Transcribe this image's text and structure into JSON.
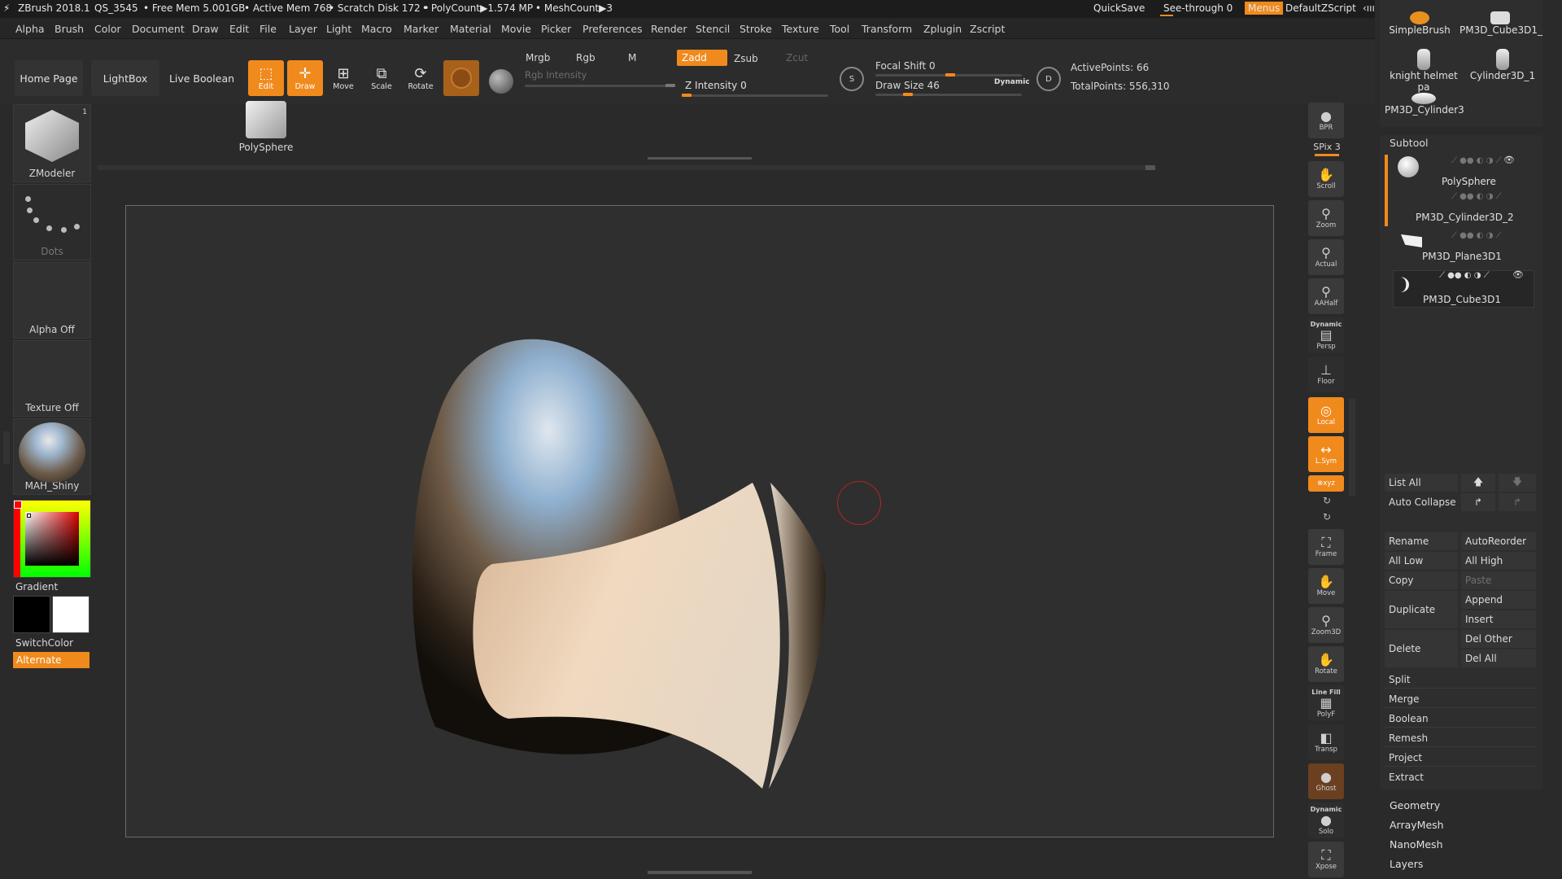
{
  "title_bar": {
    "app": "ZBrush 2018.1",
    "doc": "QS_3545",
    "free_mem": "• Free Mem 5.001GB",
    "active_mem": "• Active Mem 768",
    "scratch": "• Scratch Disk 172 •",
    "polycount": "• PolyCount▶1.574 MP",
    "meshcount": "• MeshCount▶3",
    "quicksave": "QuickSave",
    "see_through": "See-through  0",
    "menus": "Menus",
    "zscript": "DefaultZScript"
  },
  "menu": [
    "Alpha",
    "Brush",
    "Color",
    "Document",
    "Draw",
    "Edit",
    "File",
    "Layer",
    "Light",
    "Macro",
    "Marker",
    "Material",
    "Movie",
    "Picker",
    "Preferences",
    "Render",
    "Stencil",
    "Stroke",
    "Texture",
    "Tool",
    "Transform",
    "Zplugin",
    "Zscript"
  ],
  "toolbar": {
    "home": "Home Page",
    "lightbox": "LightBox",
    "live_boolean": "Live Boolean",
    "edit": "Edit",
    "draw": "Draw",
    "move": "Move",
    "scale": "Scale",
    "rotate": "Rotate",
    "mrgb": "Mrgb",
    "rgb": "Rgb",
    "m": "M",
    "zadd": "Zadd",
    "zsub": "Zsub",
    "zcut": "Zcut",
    "rgb_intensity": "Rgb Intensity",
    "z_intensity": "Z Intensity 0",
    "focal_shift": "Focal Shift 0",
    "draw_size": "Draw Size 46",
    "dynamic": "Dynamic",
    "active_points": "ActivePoints: 66",
    "total_points": "TotalPoints: 556,310",
    "polysphere_thumb": "PolySphere"
  },
  "left": {
    "brush": "ZModeler",
    "brush_count": "1",
    "stroke": "Dots",
    "alpha": "Alpha Off",
    "texture": "Texture Off",
    "material": "MAH_Shiny",
    "gradient": "Gradient",
    "switch_color": "SwitchColor",
    "alternate": "Alternate"
  },
  "right_col": {
    "bpr": "BPR",
    "spix": "SPix 3",
    "scroll": "Scroll",
    "zoom": "Zoom",
    "actual": "Actual",
    "aahalf": "AAHalf",
    "dynamic": "Dynamic",
    "persp": "Persp",
    "floor": "Floor",
    "local": "Local",
    "lsym": "L.Sym",
    "xyz": "⊗xyz",
    "frame": "Frame",
    "move": "Move",
    "zoom3d": "Zoom3D",
    "rotate": "Rotate",
    "linefill": "Line Fill",
    "polyf": "PolyF",
    "transp": "Transp",
    "ghost": "Ghost",
    "dynamic2": "Dynamic",
    "solo": "Solo",
    "xpose": "Xpose"
  },
  "tools_grid": [
    "SimpleBrush",
    "PM3D_Cube3D1_",
    "knight helmet pa",
    "Cylinder3D_1",
    "PM3D_Cylinder3"
  ],
  "subtool": {
    "title": "Subtool",
    "items": [
      "PolySphere",
      "PM3D_Cylinder3D_2",
      "PM3D_Plane3D1",
      "PM3D_Cube3D1"
    ],
    "list_all": "List All",
    "auto_collapse": "Auto Collapse",
    "rename": "Rename",
    "autoreorder": "AutoReorder",
    "all_low": "All Low",
    "all_high": "All High",
    "copy": "Copy",
    "paste": "Paste",
    "duplicate": "Duplicate",
    "append": "Append",
    "insert": "Insert",
    "delete": "Delete",
    "del_other": "Del Other",
    "del_all": "Del All",
    "split": "Split",
    "merge": "Merge",
    "boolean": "Boolean",
    "remesh": "Remesh",
    "project": "Project",
    "extract": "Extract"
  },
  "bottom_panel": [
    "Geometry",
    "ArrayMesh",
    "NanoMesh",
    "Layers"
  ],
  "colors": {
    "accent": "#f08a1c",
    "bg": "#2a2a2a"
  }
}
